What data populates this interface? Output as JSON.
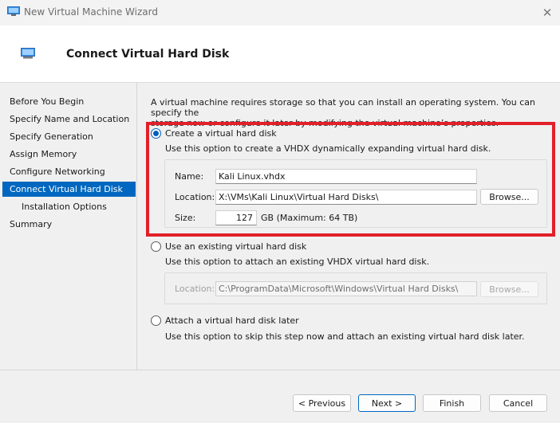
{
  "window": {
    "title": "New Virtual Machine Wizard",
    "close_glyph": "✕"
  },
  "header": {
    "page_title": "Connect Virtual Hard Disk"
  },
  "nav": {
    "items": [
      {
        "label": "Before You Begin",
        "active": false,
        "sub": false
      },
      {
        "label": "Specify Name and Location",
        "active": false,
        "sub": false
      },
      {
        "label": "Specify Generation",
        "active": false,
        "sub": false
      },
      {
        "label": "Assign Memory",
        "active": false,
        "sub": false
      },
      {
        "label": "Configure Networking",
        "active": false,
        "sub": false
      },
      {
        "label": "Connect Virtual Hard Disk",
        "active": true,
        "sub": false
      },
      {
        "label": "Installation Options",
        "active": false,
        "sub": true
      },
      {
        "label": "Summary",
        "active": false,
        "sub": false
      }
    ]
  },
  "content": {
    "intro_line1": "A virtual machine requires storage so that you can install an operating system. You can specify the",
    "intro_line2": "storage now or configure it later by modifying the virtual machine’s properties.",
    "create": {
      "label": "Create a virtual hard disk",
      "selected": true,
      "description": "Use this option to create a VHDX dynamically expanding virtual hard disk.",
      "name_label": "Name:",
      "name_value": "Kali Linux.vhdx",
      "location_label": "Location:",
      "location_value": "X:\\VMs\\Kali Linux\\Virtual Hard Disks\\",
      "browse_label": "Browse...",
      "size_label": "Size:",
      "size_value": "127",
      "size_unit": "GB (Maximum: 64 TB)"
    },
    "existing": {
      "label": "Use an existing virtual hard disk",
      "selected": false,
      "description": "Use this option to attach an existing VHDX virtual hard disk.",
      "location_label": "Location:",
      "location_value": "C:\\ProgramData\\Microsoft\\Windows\\Virtual Hard Disks\\",
      "browse_label": "Browse..."
    },
    "later": {
      "label": "Attach a virtual hard disk later",
      "selected": false,
      "description": "Use this option to skip this step now and attach an existing virtual hard disk later."
    }
  },
  "footer": {
    "previous_label": "< Previous",
    "next_label": "Next >",
    "finish_label": "Finish",
    "cancel_label": "Cancel"
  },
  "colors": {
    "accent": "#0067c0",
    "highlight": "#e1202a"
  }
}
